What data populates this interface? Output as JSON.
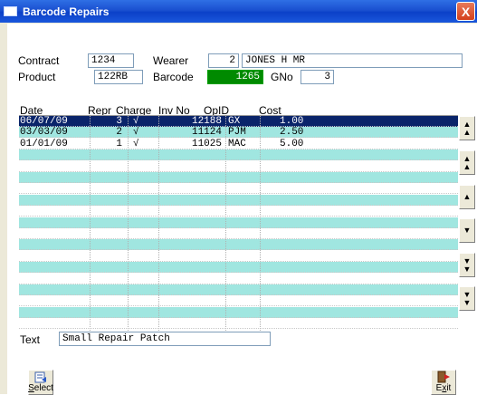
{
  "window": {
    "title": "Barcode Repairs",
    "close_glyph": "X"
  },
  "header": {
    "contract_label": "Contract",
    "contract_value": "1234",
    "wearer_label": "Wearer",
    "wearer_no": "2",
    "wearer_name": "JONES H MR",
    "product_label": "Product",
    "product_value": "122RB",
    "barcode_label": "Barcode",
    "barcode_value": "1265",
    "gno_label": "GNo",
    "gno_value": "3",
    "barcode_color": "#008a00"
  },
  "grid": {
    "columns": [
      "Date",
      "Repr",
      "Charge",
      "Inv No",
      "OpID",
      "Cost"
    ],
    "rows": [
      {
        "date": "06/07/09",
        "repr": "3",
        "charge": "√",
        "inv": "12188",
        "opid": "GX",
        "cost": "1.00"
      },
      {
        "date": "03/03/09",
        "repr": "2",
        "charge": "√",
        "inv": "11124",
        "opid": "PJM",
        "cost": "2.50"
      },
      {
        "date": "01/01/09",
        "repr": "1",
        "charge": "√",
        "inv": "11025",
        "opid": "MAC",
        "cost": "5.00"
      }
    ],
    "selected_color": "#0a246a",
    "alt_row_color": "#a0e6e0"
  },
  "scroll_buttons": [
    "first",
    "page-up",
    "up",
    "down",
    "page-down",
    "last"
  ],
  "text_label": "Text",
  "text_value": "Small Repair Patch",
  "buttons": {
    "select_first": "S",
    "select_rest": "elect",
    "exit_first": "E",
    "exit_mid": "x",
    "exit_rest": "it"
  }
}
